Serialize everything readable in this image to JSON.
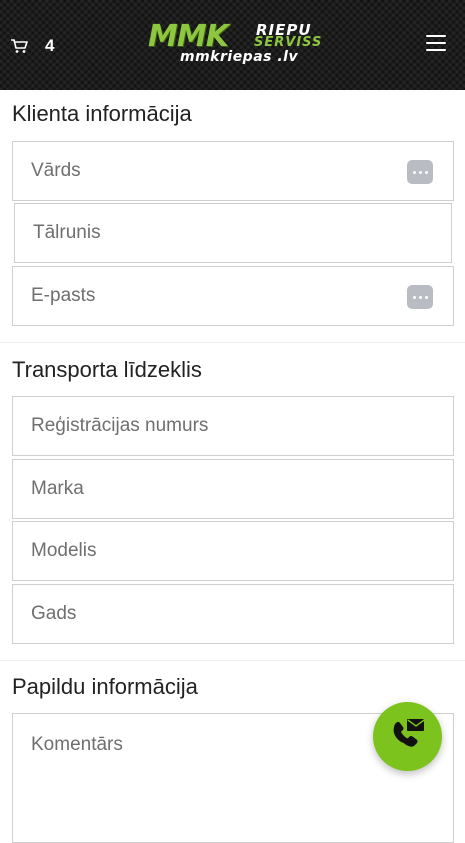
{
  "header": {
    "cart_count": "4",
    "logo": {
      "brand": "MMK",
      "riepu": "RIEPU",
      "serviss": "SERVISS",
      "domain": "mmkriepas .lv"
    },
    "colors": {
      "accent": "#8dc63f",
      "background": "#1c1c1c"
    },
    "icons": {
      "cart": "cart-icon",
      "menu": "hamburger-menu-icon"
    }
  },
  "client_section": {
    "title": "Klienta informācija",
    "fields": [
      {
        "placeholder": "Vārds",
        "keypass_icon": true
      },
      {
        "placeholder": "Tālrunis",
        "keypass_icon": false
      },
      {
        "placeholder": "E-pasts",
        "keypass_icon": true
      }
    ]
  },
  "vehicle_section": {
    "title": "Transporta līdzeklis",
    "fields": [
      {
        "placeholder": "Reģistrācijas numurs"
      },
      {
        "placeholder": "Marka"
      },
      {
        "placeholder": "Modelis"
      },
      {
        "placeholder": "Gads"
      }
    ]
  },
  "extra_section": {
    "title": "Papildu informācija",
    "comment_placeholder": "Komentārs"
  },
  "fab": {
    "icon": "phone-mail-icon",
    "color": "#7cc41d"
  }
}
